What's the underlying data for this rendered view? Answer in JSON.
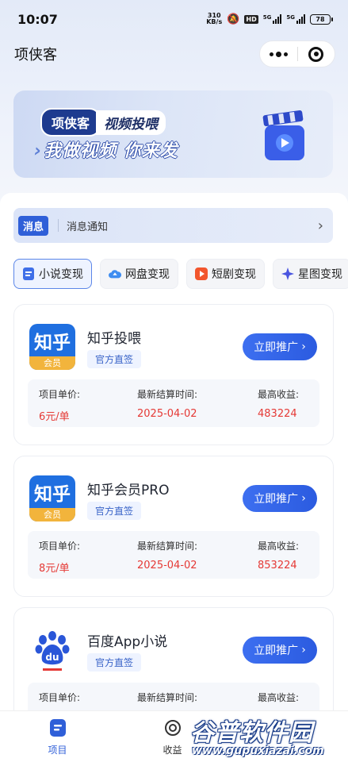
{
  "status_bar": {
    "time": "10:07",
    "net_speed_value": "310",
    "net_speed_unit": "KB/s",
    "hd": "HD",
    "signal1": "5G",
    "signal2": "5G",
    "battery": "78"
  },
  "header": {
    "title": "项侠客"
  },
  "banner": {
    "brand": "项侠客",
    "subtitle": "视频投喂",
    "slogan": "我做视频 你来发"
  },
  "notice": {
    "tag": "消息",
    "text": "消息通知"
  },
  "tabs": [
    {
      "label": "小说变现",
      "icon": "book-icon",
      "active": true
    },
    {
      "label": "网盘变现",
      "icon": "cloud-icon"
    },
    {
      "label": "短剧变现",
      "icon": "play-icon"
    },
    {
      "label": "星图变现",
      "icon": "star-icon"
    }
  ],
  "cards": [
    {
      "name": "知乎投喂",
      "tag": "官方直签",
      "button": "立即推广",
      "logo": "zhihu-logo",
      "logo_text": "知乎",
      "logo_badge": "会员",
      "stats": [
        {
          "label": "项目单价:",
          "value": "6元/单"
        },
        {
          "label": "最新结算时间:",
          "value": "2025-04-02"
        },
        {
          "label": "最高收益:",
          "value": "483224"
        }
      ]
    },
    {
      "name": "知乎会员PRO",
      "tag": "官方直签",
      "button": "立即推广",
      "logo": "zhihu-logo",
      "logo_text": "知乎",
      "logo_badge": "会员",
      "stats": [
        {
          "label": "项目单价:",
          "value": "8元/单"
        },
        {
          "label": "最新结算时间:",
          "value": "2025-04-02"
        },
        {
          "label": "最高收益:",
          "value": "853224"
        }
      ]
    },
    {
      "name": "百度App小说",
      "tag": "官方直签",
      "button": "立即推广",
      "logo": "baidu-logo",
      "logo_text": "du",
      "stats": [
        {
          "label": "项目单价:",
          "value": ""
        },
        {
          "label": "最新结算时间:",
          "value": ""
        },
        {
          "label": "最高收益:",
          "value": ""
        }
      ]
    }
  ],
  "bottom_nav": [
    {
      "label": "项目",
      "icon": "project-icon",
      "active": true
    },
    {
      "label": "收益",
      "icon": "earnings-icon"
    }
  ],
  "watermark": {
    "title": "谷普软件园",
    "url": "www.gupuxiazai.com"
  },
  "colors": {
    "accent": "#2f5fd8",
    "price_red": "#e53935",
    "zhihu_blue": "#1f6fe0",
    "vip_gold": "#f2b43c"
  }
}
